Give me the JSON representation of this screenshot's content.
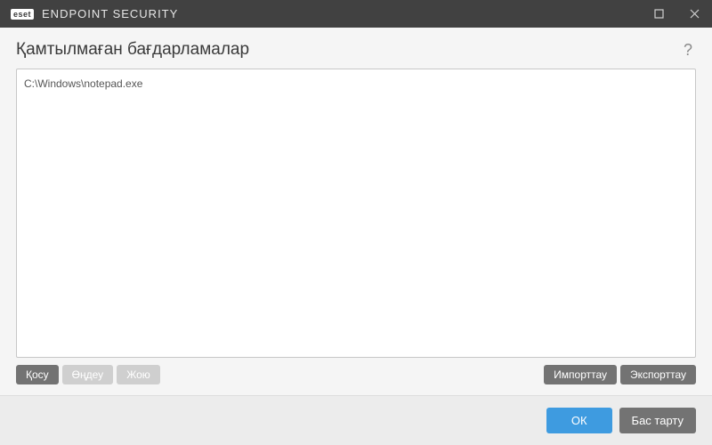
{
  "titlebar": {
    "brand_prefix": "eset",
    "brand_text": "ENDPOINT SECURITY"
  },
  "header": {
    "title": "Қамтылмаған бағдарламалар",
    "help": "?"
  },
  "list": {
    "items": [
      "C:\\Windows\\notepad.exe"
    ]
  },
  "toolbar": {
    "add": "Қосу",
    "edit": "Өңдеу",
    "delete": "Жою",
    "import": "Импорттау",
    "export": "Экспорттау"
  },
  "footer": {
    "ok": "ОК",
    "cancel": "Бас тарту"
  }
}
